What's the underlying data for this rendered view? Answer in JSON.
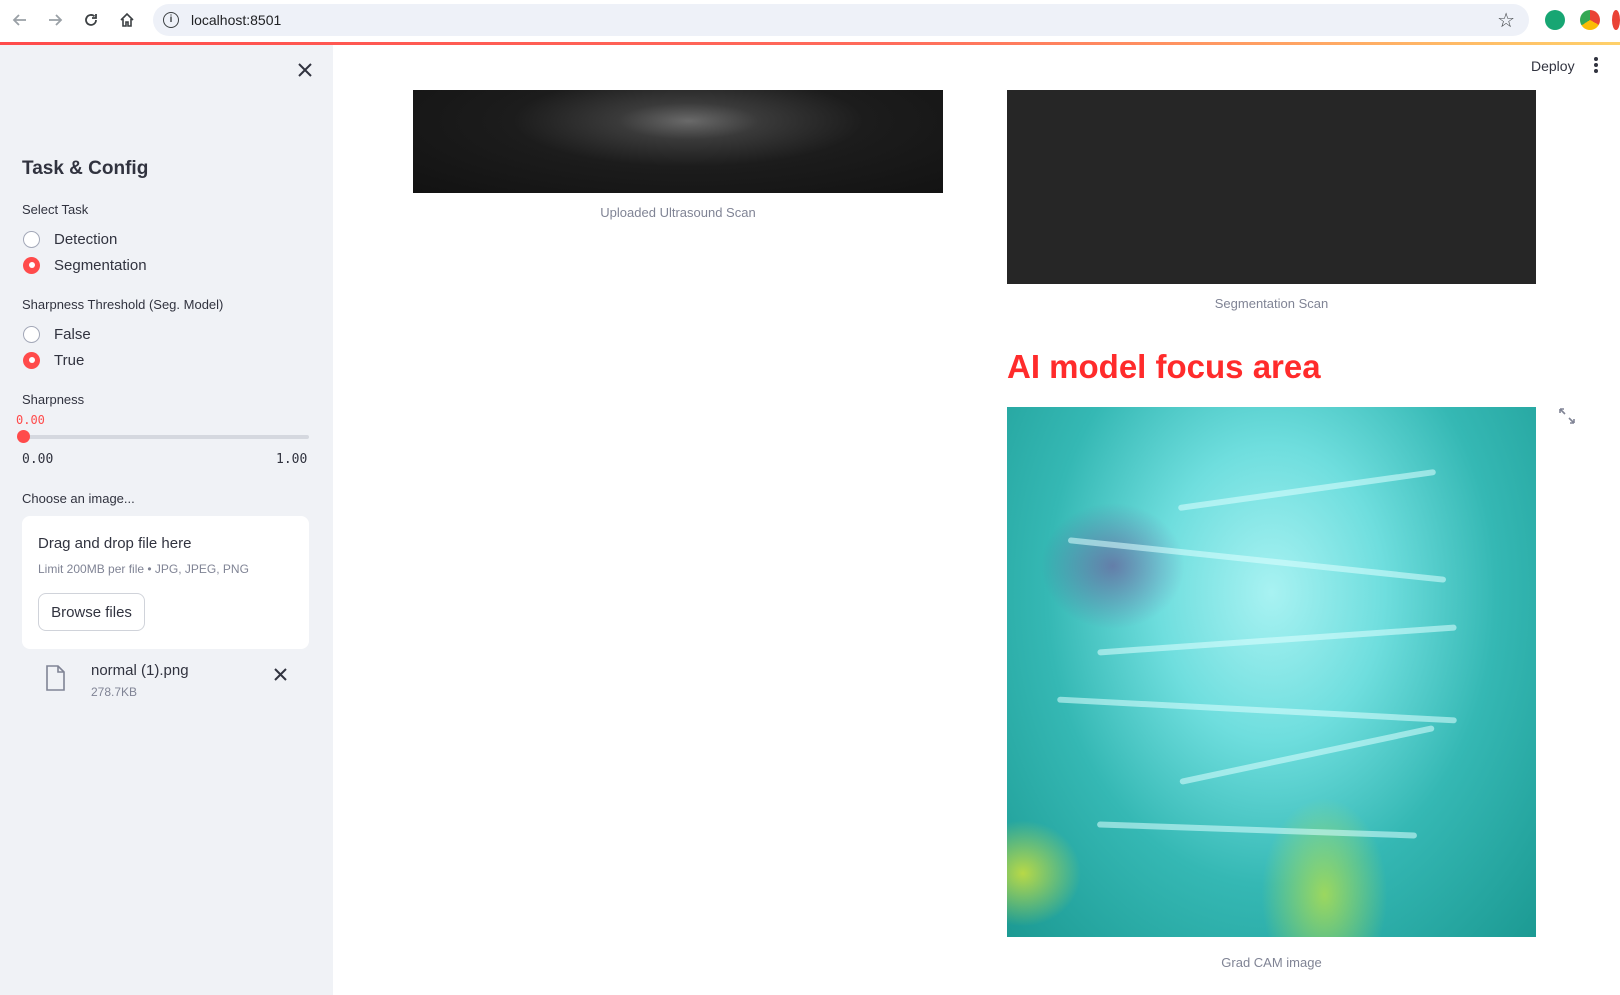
{
  "browser": {
    "url": "localhost:8501",
    "back_icon": "arrow-left-icon",
    "forward_icon": "arrow-right-icon",
    "reload_icon": "reload-icon",
    "home_icon": "home-icon"
  },
  "sidebar": {
    "title": "Task & Config",
    "task": {
      "label": "Select Task",
      "options": [
        "Detection",
        "Segmentation"
      ],
      "selected": "Segmentation"
    },
    "sharpness_threshold": {
      "label": "Sharpness Threshold (Seg. Model)",
      "options": [
        "False",
        "True"
      ],
      "selected": "True"
    },
    "sharpness": {
      "label": "Sharpness",
      "value": "0.00",
      "min": "0.00",
      "max": "1.00",
      "fraction": 0.0
    },
    "uploader": {
      "label": "Choose an image...",
      "drop_text": "Drag and drop file here",
      "limit_text": "Limit 200MB per file • JPG, JPEG, PNG",
      "browse_label": "Browse files",
      "file_name": "normal (1).png",
      "file_size": "278.7KB"
    }
  },
  "header": {
    "deploy_label": "Deploy"
  },
  "main": {
    "upload_caption": "Uploaded Ultrasound Scan",
    "segmentation_caption": "Segmentation Scan",
    "focus_title": "AI model focus area",
    "gradcam_caption": "Grad CAM image"
  },
  "colors": {
    "accent": "#ff4b4b",
    "focus_title": "#ff2b2b",
    "sidebar_bg": "#f0f2f6"
  }
}
